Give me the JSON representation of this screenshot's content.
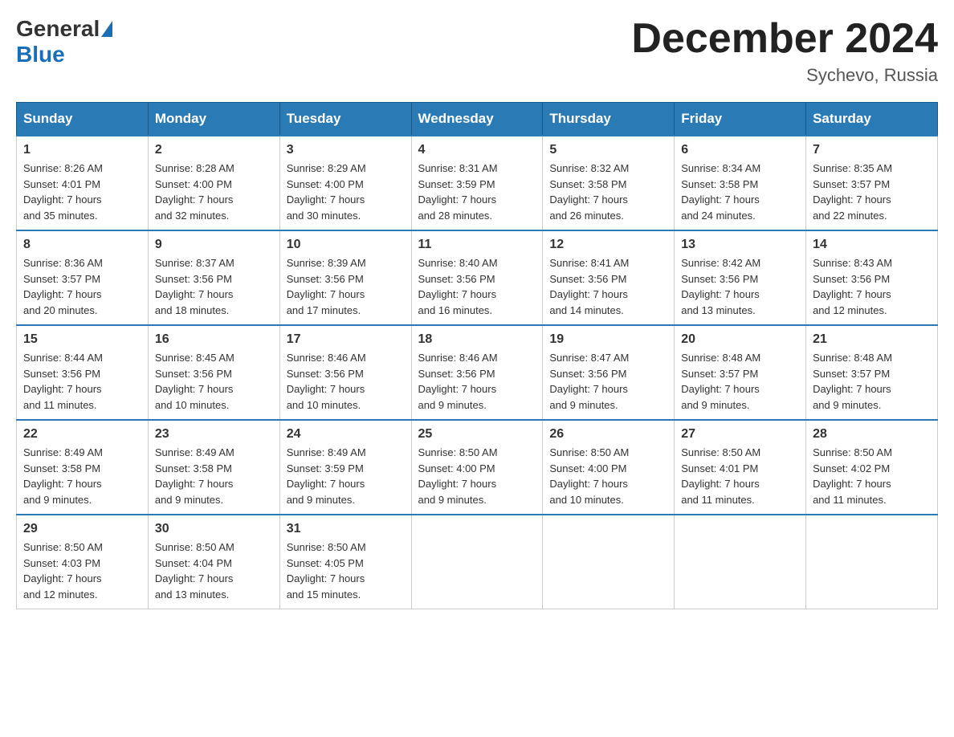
{
  "header": {
    "logo_general": "General",
    "logo_blue": "Blue",
    "month_year": "December 2024",
    "location": "Sychevo, Russia"
  },
  "weekdays": [
    "Sunday",
    "Monday",
    "Tuesday",
    "Wednesday",
    "Thursday",
    "Friday",
    "Saturday"
  ],
  "weeks": [
    [
      {
        "day": "1",
        "sunrise": "8:26 AM",
        "sunset": "4:01 PM",
        "daylight": "7 hours and 35 minutes."
      },
      {
        "day": "2",
        "sunrise": "8:28 AM",
        "sunset": "4:00 PM",
        "daylight": "7 hours and 32 minutes."
      },
      {
        "day": "3",
        "sunrise": "8:29 AM",
        "sunset": "4:00 PM",
        "daylight": "7 hours and 30 minutes."
      },
      {
        "day": "4",
        "sunrise": "8:31 AM",
        "sunset": "3:59 PM",
        "daylight": "7 hours and 28 minutes."
      },
      {
        "day": "5",
        "sunrise": "8:32 AM",
        "sunset": "3:58 PM",
        "daylight": "7 hours and 26 minutes."
      },
      {
        "day": "6",
        "sunrise": "8:34 AM",
        "sunset": "3:58 PM",
        "daylight": "7 hours and 24 minutes."
      },
      {
        "day": "7",
        "sunrise": "8:35 AM",
        "sunset": "3:57 PM",
        "daylight": "7 hours and 22 minutes."
      }
    ],
    [
      {
        "day": "8",
        "sunrise": "8:36 AM",
        "sunset": "3:57 PM",
        "daylight": "7 hours and 20 minutes."
      },
      {
        "day": "9",
        "sunrise": "8:37 AM",
        "sunset": "3:56 PM",
        "daylight": "7 hours and 18 minutes."
      },
      {
        "day": "10",
        "sunrise": "8:39 AM",
        "sunset": "3:56 PM",
        "daylight": "7 hours and 17 minutes."
      },
      {
        "day": "11",
        "sunrise": "8:40 AM",
        "sunset": "3:56 PM",
        "daylight": "7 hours and 16 minutes."
      },
      {
        "day": "12",
        "sunrise": "8:41 AM",
        "sunset": "3:56 PM",
        "daylight": "7 hours and 14 minutes."
      },
      {
        "day": "13",
        "sunrise": "8:42 AM",
        "sunset": "3:56 PM",
        "daylight": "7 hours and 13 minutes."
      },
      {
        "day": "14",
        "sunrise": "8:43 AM",
        "sunset": "3:56 PM",
        "daylight": "7 hours and 12 minutes."
      }
    ],
    [
      {
        "day": "15",
        "sunrise": "8:44 AM",
        "sunset": "3:56 PM",
        "daylight": "7 hours and 11 minutes."
      },
      {
        "day": "16",
        "sunrise": "8:45 AM",
        "sunset": "3:56 PM",
        "daylight": "7 hours and 10 minutes."
      },
      {
        "day": "17",
        "sunrise": "8:46 AM",
        "sunset": "3:56 PM",
        "daylight": "7 hours and 10 minutes."
      },
      {
        "day": "18",
        "sunrise": "8:46 AM",
        "sunset": "3:56 PM",
        "daylight": "7 hours and 9 minutes."
      },
      {
        "day": "19",
        "sunrise": "8:47 AM",
        "sunset": "3:56 PM",
        "daylight": "7 hours and 9 minutes."
      },
      {
        "day": "20",
        "sunrise": "8:48 AM",
        "sunset": "3:57 PM",
        "daylight": "7 hours and 9 minutes."
      },
      {
        "day": "21",
        "sunrise": "8:48 AM",
        "sunset": "3:57 PM",
        "daylight": "7 hours and 9 minutes."
      }
    ],
    [
      {
        "day": "22",
        "sunrise": "8:49 AM",
        "sunset": "3:58 PM",
        "daylight": "7 hours and 9 minutes."
      },
      {
        "day": "23",
        "sunrise": "8:49 AM",
        "sunset": "3:58 PM",
        "daylight": "7 hours and 9 minutes."
      },
      {
        "day": "24",
        "sunrise": "8:49 AM",
        "sunset": "3:59 PM",
        "daylight": "7 hours and 9 minutes."
      },
      {
        "day": "25",
        "sunrise": "8:50 AM",
        "sunset": "4:00 PM",
        "daylight": "7 hours and 9 minutes."
      },
      {
        "day": "26",
        "sunrise": "8:50 AM",
        "sunset": "4:00 PM",
        "daylight": "7 hours and 10 minutes."
      },
      {
        "day": "27",
        "sunrise": "8:50 AM",
        "sunset": "4:01 PM",
        "daylight": "7 hours and 11 minutes."
      },
      {
        "day": "28",
        "sunrise": "8:50 AM",
        "sunset": "4:02 PM",
        "daylight": "7 hours and 11 minutes."
      }
    ],
    [
      {
        "day": "29",
        "sunrise": "8:50 AM",
        "sunset": "4:03 PM",
        "daylight": "7 hours and 12 minutes."
      },
      {
        "day": "30",
        "sunrise": "8:50 AM",
        "sunset": "4:04 PM",
        "daylight": "7 hours and 13 minutes."
      },
      {
        "day": "31",
        "sunrise": "8:50 AM",
        "sunset": "4:05 PM",
        "daylight": "7 hours and 15 minutes."
      },
      null,
      null,
      null,
      null
    ]
  ],
  "labels": {
    "sunrise": "Sunrise:",
    "sunset": "Sunset:",
    "daylight": "Daylight:"
  }
}
